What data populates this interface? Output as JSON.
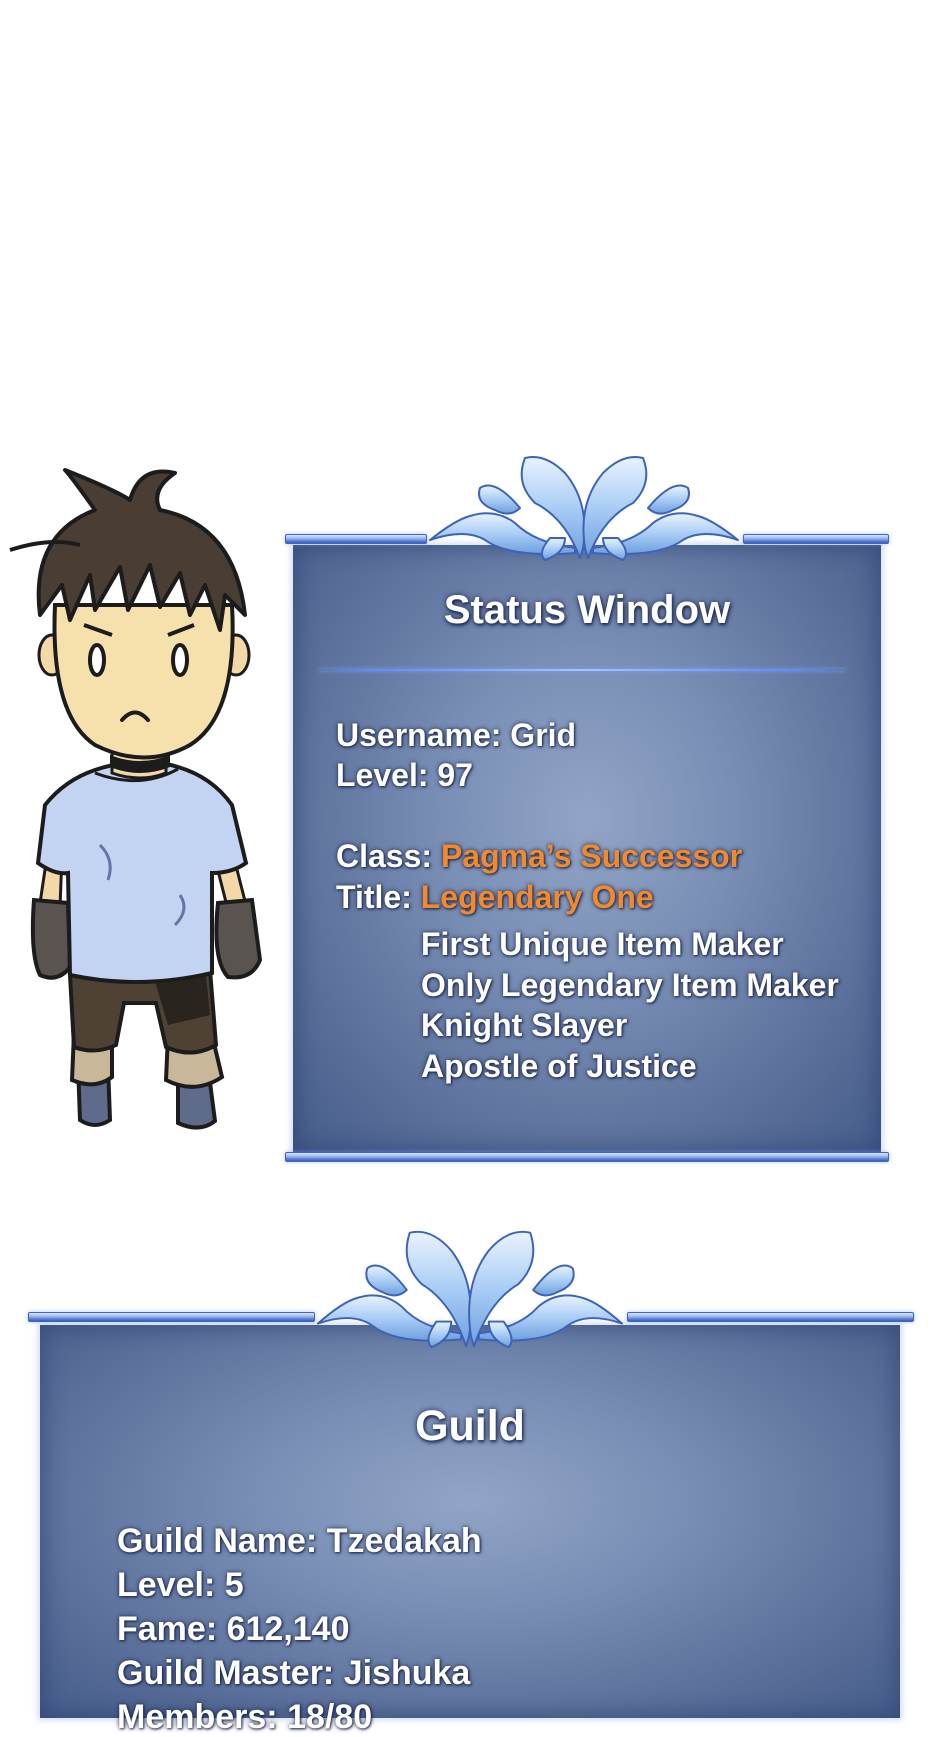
{
  "status_window": {
    "title": "Status Window",
    "username_label": "Username: ",
    "username": "Grid",
    "level_label": "Level: ",
    "level": "97",
    "class_label": "Class: ",
    "class": "Pagma’s Successor",
    "title_label": "Title: ",
    "title_value": "Legendary One",
    "sub_titles": [
      "First Unique Item Maker",
      "Only Legendary Item Maker",
      "Knight Slayer",
      "Apostle of Justice"
    ]
  },
  "guild_window": {
    "title": "Guild",
    "name_label": "Guild Name: ",
    "name": "Tzedakah",
    "level_label": "Level: ",
    "level": "5",
    "fame_label": "Fame: ",
    "fame": "612,140",
    "master_label": "Guild Master: ",
    "master": "Jishuka",
    "members_label": "Members: ",
    "members": "18/80"
  },
  "colors": {
    "panel": "#6e85af",
    "rail": "#9fb9f2",
    "highlight_text": "#f2892a",
    "text": "#ffffff"
  },
  "icons": {
    "character": "chibi-character-grid",
    "crest": "wing-crest-ornament"
  }
}
